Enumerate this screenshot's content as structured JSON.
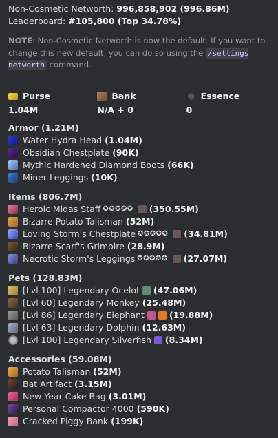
{
  "header": {
    "networth_label": "Non-Cosmetic Networth:",
    "networth_value": "996,858,902 (996.86M)",
    "leaderboard_label": "Leaderboard:",
    "leaderboard_value": "#105,800 (Top 34.78%)"
  },
  "note": {
    "label": "NOTE",
    "text1": ": Non-Cosmetic Networth is now the default. If you want to change this new default, you can do so using the",
    "command": "/settings networth",
    "text2": "command."
  },
  "fields": [
    {
      "name": "Purse",
      "icon": "purse-icon",
      "value": "1.04M"
    },
    {
      "name": "Bank",
      "icon": "bank-icon",
      "value": "N/A + 0"
    },
    {
      "name": "Essence",
      "icon": "essence-icon",
      "value": "0"
    }
  ],
  "sections": {
    "armor": {
      "title": "Armor (1.21M)",
      "items": [
        {
          "name": "Water Hydra Head",
          "value": "(1.04M)"
        },
        {
          "name": "Obsidian Chestplate",
          "value": "(90K)"
        },
        {
          "name": "Mythic Hardened Diamond Boots",
          "value": "(66K)"
        },
        {
          "name": "Miner Leggings",
          "value": "(10K)"
        }
      ]
    },
    "items": {
      "title": "Items (806.7M)",
      "items": [
        {
          "name": "Heroic Midas Staff",
          "stars": "✪✪✪✪✪",
          "value": "(350.55M)"
        },
        {
          "name": "Bizarre Potato Talisman",
          "value": "(52M)"
        },
        {
          "name": "Loving Storm's Chestplate",
          "stars": "✪✪✪✪✪",
          "value": "(34.81M)"
        },
        {
          "name": "Bizarre Scarf's Grimoire",
          "value": "(28.9M)"
        },
        {
          "name": "Necrotic Storm's Leggings",
          "stars": "✪✪✪✪✪",
          "value": "(27.07M)"
        }
      ]
    },
    "pets": {
      "title": "Pets (128.83M)",
      "items": [
        {
          "name": "[Lvl 100] Legendary Ocelot",
          "value": "(47.06M)"
        },
        {
          "name": "[Lvl 60] Legendary Monkey",
          "value": "(25.48M)"
        },
        {
          "name": "[Lvl 86] Legendary Elephant",
          "value": "(19.88M)"
        },
        {
          "name": "[Lvl 63] Legendary Dolphin",
          "value": "(12.63M)"
        },
        {
          "name": "[Lvl 100] Legendary Silverfish",
          "value": "(8.34M)"
        }
      ]
    },
    "accessories": {
      "title": "Accessories (59.08M)",
      "items": [
        {
          "name": "Potato Talisman",
          "value": "(52M)"
        },
        {
          "name": "Bat Artifact",
          "value": "(3.15M)"
        },
        {
          "name": "New Year Cake Bag",
          "value": "(3.01M)"
        },
        {
          "name": "Personal Compactor 4000",
          "value": "(590K)"
        },
        {
          "name": "Cracked Piggy Bank",
          "value": "(199K)"
        }
      ]
    }
  }
}
